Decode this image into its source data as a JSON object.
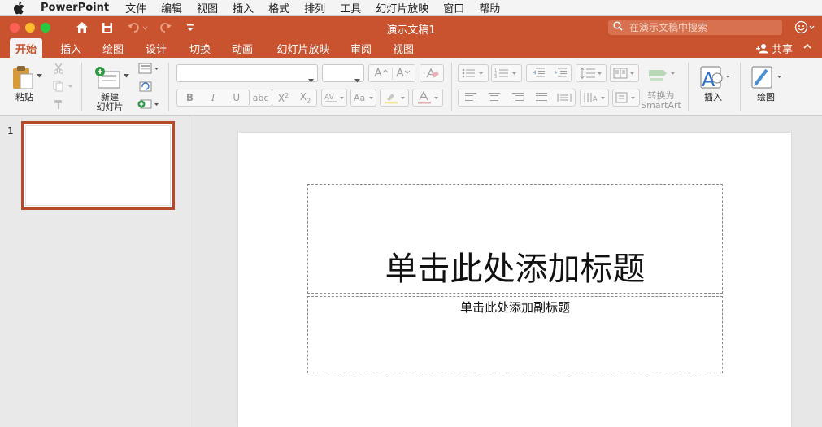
{
  "menubar": {
    "app_name": "PowerPoint",
    "items": [
      "文件",
      "编辑",
      "视图",
      "插入",
      "格式",
      "排列",
      "工具",
      "幻灯片放映",
      "窗口",
      "帮助"
    ]
  },
  "titlebar": {
    "doc_title": "演示文稿1",
    "search_placeholder": "在演示文稿中搜索"
  },
  "tabs": [
    "开始",
    "插入",
    "绘图",
    "设计",
    "切换",
    "动画",
    "幻灯片放映",
    "审阅",
    "视图"
  ],
  "active_tab": "开始",
  "share_label": "共享",
  "ribbon": {
    "paste_label": "粘贴",
    "new_slide_label_1": "新建",
    "new_slide_label_2": "幻灯片",
    "convert_label_1": "转换为",
    "convert_label_2": "SmartArt",
    "insert_label": "插入",
    "draw_label": "绘图",
    "font_name": "",
    "font_size": ""
  },
  "thumbnails": [
    {
      "number": "1"
    }
  ],
  "slide": {
    "title_placeholder": "单击此处添加标题",
    "subtitle_placeholder": "单击此处添加副标题"
  },
  "colors": {
    "accent": "#c9522f",
    "ribbon_bg": "#f3f3f3",
    "canvas_bg": "#e7e7e7"
  },
  "icons": [
    "apple-icon",
    "home-icon",
    "save-icon",
    "undo-icon",
    "redo-icon",
    "customize-icon",
    "search-icon",
    "smiley-icon",
    "add-person-icon",
    "chevron-up-icon"
  ]
}
